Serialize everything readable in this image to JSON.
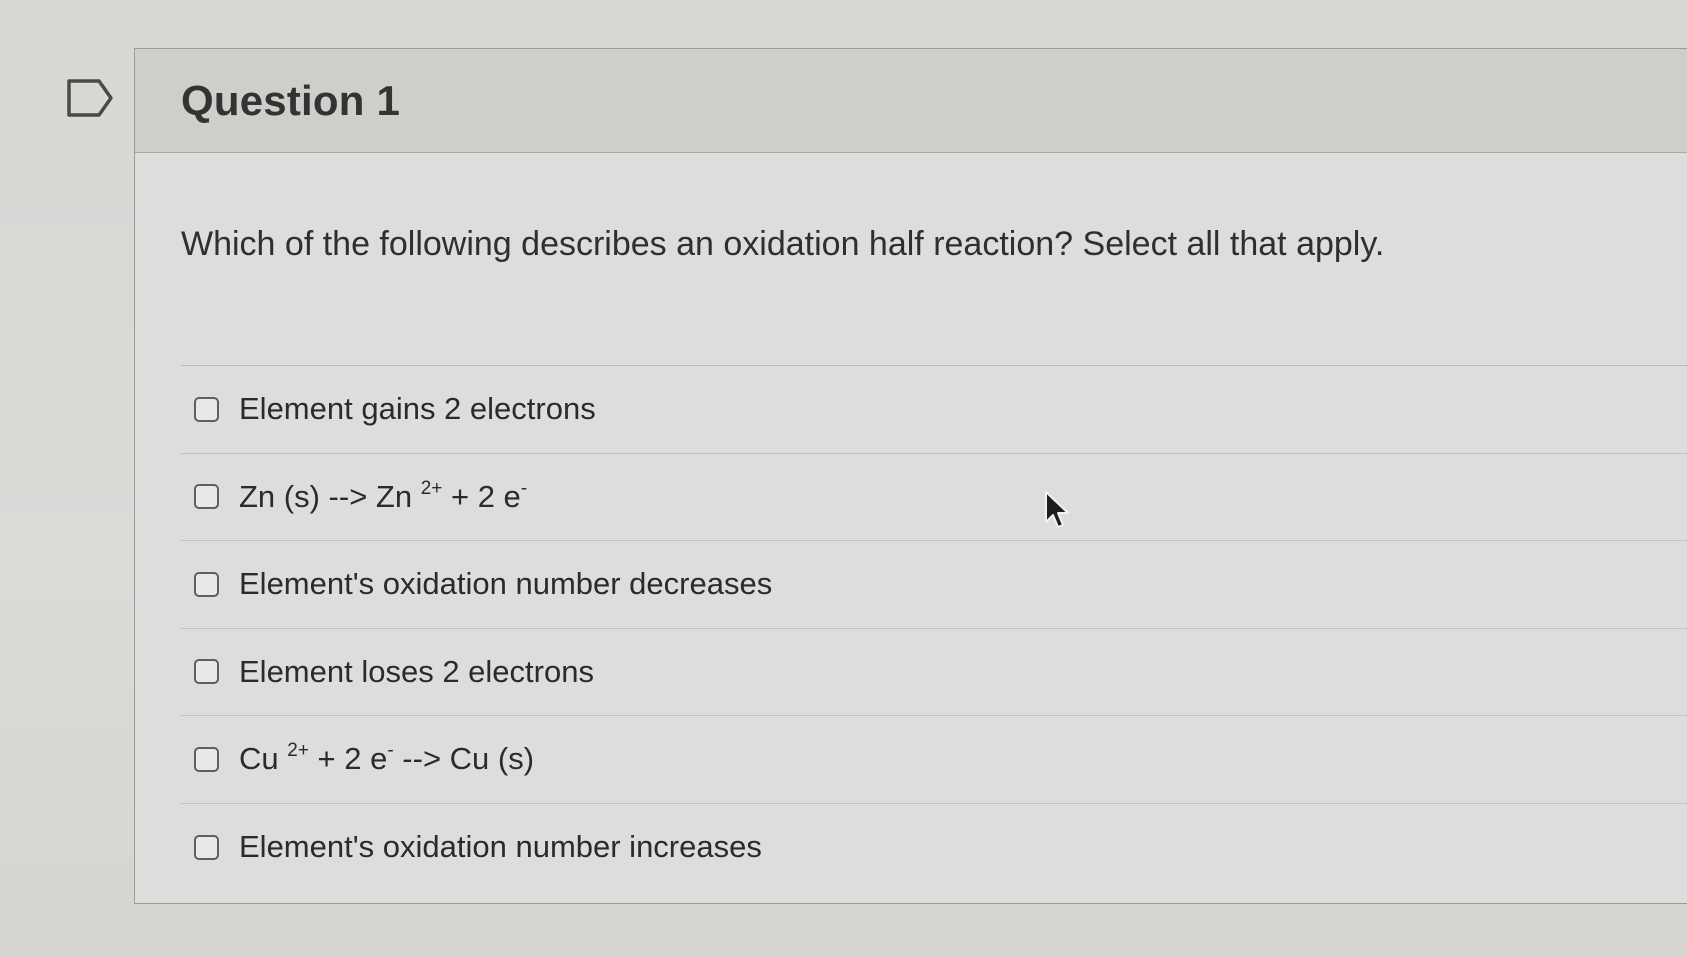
{
  "question": {
    "title": "Question 1",
    "prompt": "Which of the following describes an oxidation half reaction? Select all that apply.",
    "options": [
      {
        "parts": [
          "Element gains 2 electrons"
        ]
      },
      {
        "parts": [
          "Zn (s) --> Zn ",
          "2+",
          " + 2 e",
          "-"
        ]
      },
      {
        "parts": [
          "Element's oxidation number decreases"
        ]
      },
      {
        "parts": [
          "Element loses 2 electrons"
        ]
      },
      {
        "parts": [
          "Cu ",
          "2+",
          " + 2 e",
          "-",
          " --> Cu (s)"
        ]
      },
      {
        "parts": [
          "Element's oxidation number increases"
        ]
      }
    ]
  },
  "icons": {
    "flag": "flag-icon",
    "cursor": "mouse-pointer-icon",
    "checkbox": "checkbox-icon"
  }
}
